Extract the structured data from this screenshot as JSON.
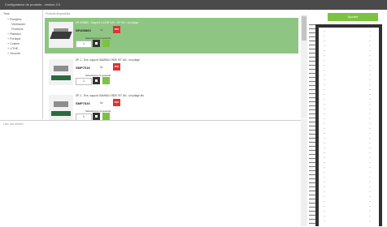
{
  "window": {
    "title": "Configurateur de produits - version 2.0"
  },
  "tree": {
    "items": [
      {
        "label": "Tous",
        "level": 0
      },
      {
        "label": "+ Rangées",
        "level": 1
      },
      {
        "label": "Ventilación",
        "level": 2
      },
      {
        "label": "Fixations",
        "level": 2
      },
      {
        "label": "+ Plateaux",
        "level": 1
      },
      {
        "label": "+ Portique",
        "level": 1
      },
      {
        "label": "+ Cuisine",
        "level": 1
      },
      {
        "label": "+ LITHE",
        "level": 1
      },
      {
        "label": "+ Sécurité",
        "level": 1
      }
    ]
  },
  "list": {
    "header": "Produits disponibles",
    "products": [
      {
        "name": "SP-400860 - Support LI-LINE 120 - 90° AN - uni pliage",
        "code": "SP400860",
        "for_label": "for",
        "pdf_label": "PDF",
        "add_label": "Sélectionner la quantité",
        "qty": "1",
        "selected": true
      },
      {
        "name": "SP-1 - Ens. support GAMMA 2 REB. 90° AN - uni pliage",
        "code": "SMP7019",
        "for_label": "for",
        "pdf_label": "PDF",
        "add_label": "Sélectionner la quantité",
        "qty": "1",
        "selected": false
      },
      {
        "name": "SP-1 - Ens. support GAMMA 2 REB. 90° AN - uni pliage bis",
        "code": "SMP7020",
        "for_label": "for",
        "pdf_label": "PDF",
        "add_label": "Sélectionner la quantité",
        "qty": "1",
        "selected": false
      }
    ]
  },
  "bottom": {
    "label": "Liste des articles"
  },
  "right": {
    "add_button": "Ajouter"
  },
  "colors": {
    "accent": "#7dc242",
    "selected_row": "#8fc583",
    "titlebar": "#4a4a4a"
  }
}
